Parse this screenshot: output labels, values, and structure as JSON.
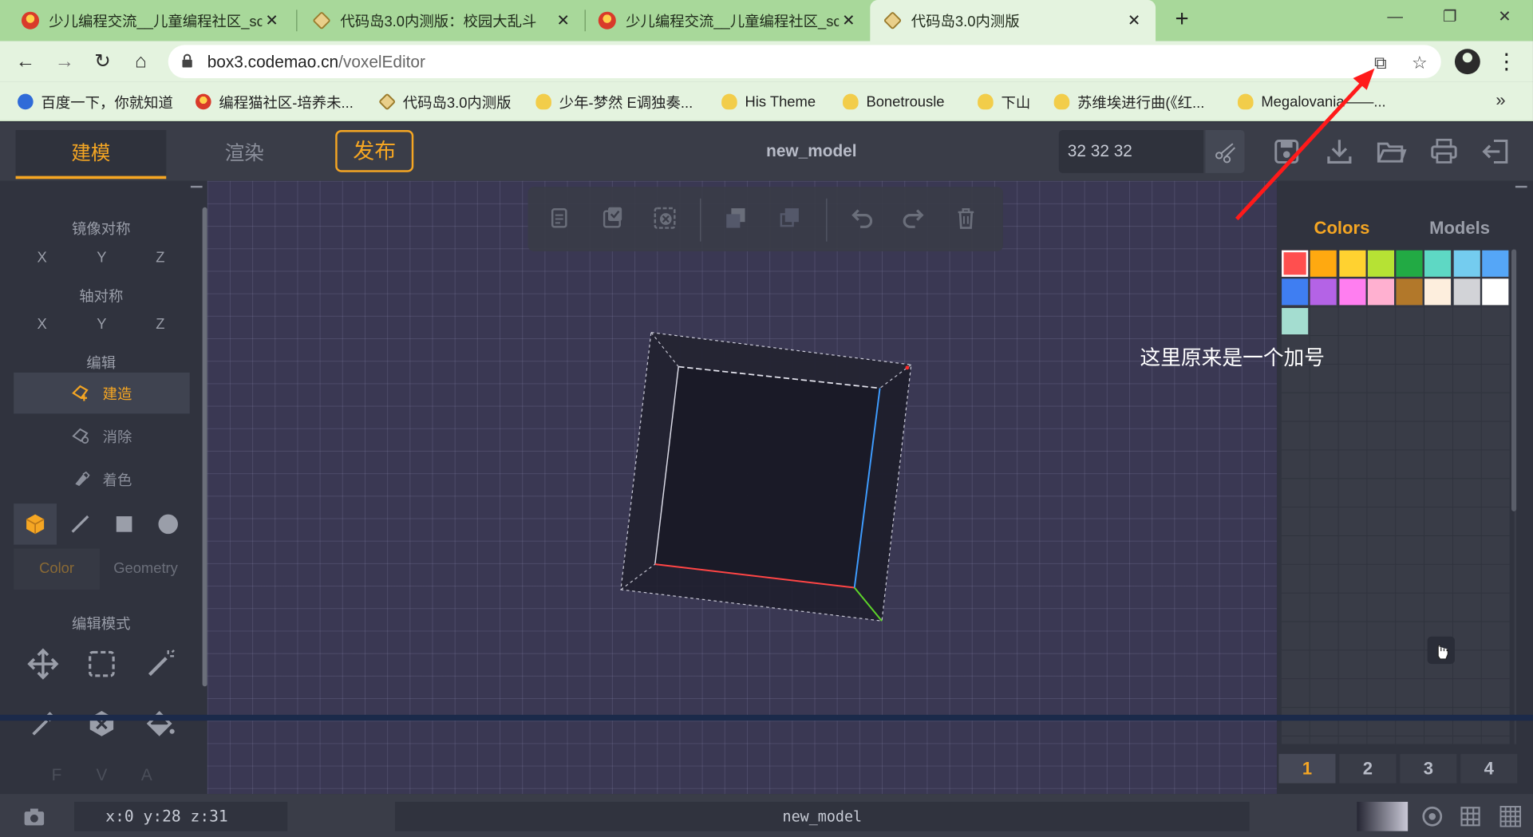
{
  "browser": {
    "tabs": [
      {
        "title": "少儿编程交流__儿童编程社区_sc",
        "icon": "codemao-icon",
        "active": false
      },
      {
        "title": "代码岛3.0内测版：校园大乱斗",
        "icon": "box3-icon",
        "active": false
      },
      {
        "title": "少儿编程交流__儿童编程社区_sc",
        "icon": "codemao-icon",
        "active": false
      },
      {
        "title": "代码岛3.0内测版",
        "icon": "box3-icon",
        "active": true
      }
    ],
    "new_tab_label": "+",
    "url_host": "box3.codemao.cn",
    "url_path": "/voxelEditor",
    "bookmarks": [
      "百度一下，你就知道",
      "编程猫社区-培养未...",
      "代码岛3.0内测版",
      "少年-梦然 E调独奏...",
      "His Theme",
      "Bonetrousle",
      "下山",
      "苏维埃进行曲(《红...",
      "Megalovania——..."
    ],
    "bookmarks_more": "»"
  },
  "header": {
    "tab_model": "建模",
    "tab_render": "渲染",
    "publish": "发布",
    "model_name": "new_model",
    "dimensions": "32  32  32"
  },
  "left_panel": {
    "mirror_title": "镜像对称",
    "axis_title": "轴对称",
    "axes": [
      "X",
      "Y",
      "Z"
    ],
    "edit_title": "编辑",
    "edit_items": [
      "建造",
      "消除",
      "着色"
    ],
    "selected_edit": "建造",
    "mode_tabs": [
      "Color",
      "Geometry"
    ],
    "edit_mode_title": "编辑模式",
    "fva": [
      "F",
      "V",
      "A"
    ]
  },
  "right_panel": {
    "tab_colors": "Colors",
    "tab_models": "Models",
    "swatches": [
      "#ff4f4f",
      "#ffa910",
      "#ffd230",
      "#b6e234",
      "#22aa44",
      "#5ed8c4",
      "#74ccef",
      "#55a6f7",
      "#3f7ef2",
      "#b463e6",
      "#ff7ef0",
      "#ffb0d0",
      "#b2782a",
      "#fdeedd",
      "#d2d3d7",
      "#ffffff",
      "#a4ddd0"
    ],
    "selected_swatch": 0,
    "pages": [
      "1",
      "2",
      "3",
      "4"
    ],
    "selected_page": "1"
  },
  "annotation": "这里原来是一个加号",
  "status": {
    "coords": "x:0 y:28 z:31",
    "model_name": "new_model"
  },
  "colors": {
    "accent": "#f5a623",
    "browser_tab_bar": "#a8d89a",
    "viewport_bg": "#3a3853",
    "arrow": "#ff1a1a"
  }
}
